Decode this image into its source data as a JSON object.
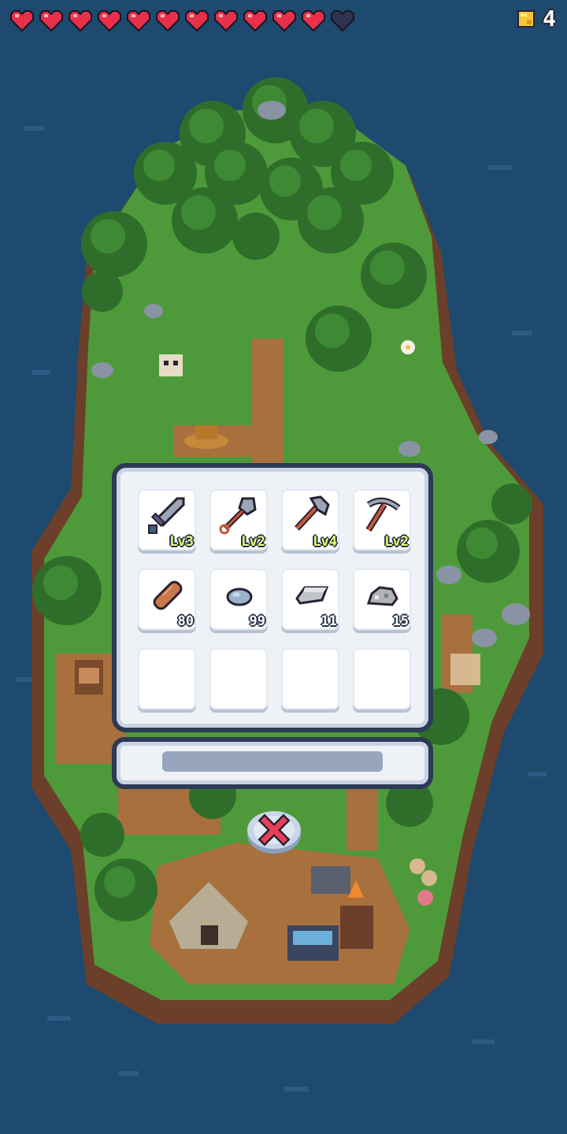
{
  "hud": {
    "hearts_full": 11,
    "hearts_total": 12,
    "heart_color": "#e8304a",
    "heart_empty_color": "#2e3450",
    "coin_icon": "coin-icon",
    "coin_count": "4"
  },
  "inventory": {
    "tools": [
      {
        "name": "sword",
        "icon": "sword-icon",
        "level": "Lv3"
      },
      {
        "name": "shovel",
        "icon": "shovel-icon",
        "level": "Lv2"
      },
      {
        "name": "axe",
        "icon": "axe-icon",
        "level": "Lv4"
      },
      {
        "name": "pickaxe",
        "icon": "pickaxe-icon",
        "level": "Lv2"
      }
    ],
    "resources": [
      {
        "name": "wood",
        "icon": "wood-log-icon",
        "count": "80"
      },
      {
        "name": "stone",
        "icon": "stone-icon",
        "count": "99"
      },
      {
        "name": "iron-bar",
        "icon": "iron-ingot-icon",
        "count": "11"
      },
      {
        "name": "ore",
        "icon": "ore-icon",
        "count": "15"
      }
    ],
    "empty_slots": 4
  },
  "close_button": {
    "icon": "close-icon"
  },
  "colors": {
    "ocean": "#1d4a6e",
    "grass": "#4e9a3a",
    "dirt": "#a8703c",
    "panel": "#eef2f7",
    "panel_border": "#2d3a56",
    "level_text": "#e8ff75",
    "close_red": "#e84058"
  }
}
